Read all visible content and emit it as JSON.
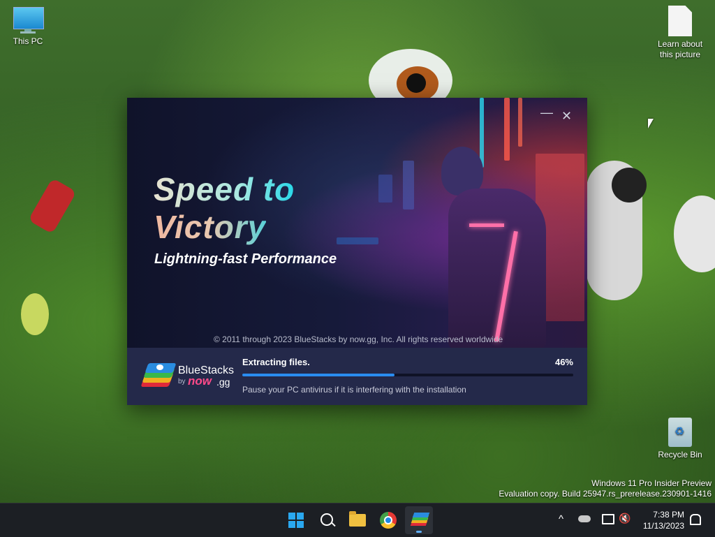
{
  "desktop": {
    "icons": {
      "this_pc": "This PC",
      "learn": "Learn about this picture",
      "recycle_bin": "Recycle Bin"
    },
    "watermark": {
      "line1": "Windows 11 Pro Insider Preview",
      "line2": "Evaluation copy. Build 25947.rs_prerelease.230901-1416"
    }
  },
  "installer": {
    "headline_1": "Speed to",
    "headline_2": "Victory",
    "subheadline": "Lightning-fast Performance",
    "copyright": "© 2011 through 2023 BlueStacks by now.gg, Inc. All rights reserved worldwide",
    "brand": "BlueStacks",
    "brand_by": "by",
    "brand_now": "now",
    "brand_gg": ".gg",
    "status": "Extracting files.",
    "progress_label": "46%",
    "progress": 0.46,
    "hint": "Pause your PC antivirus if it is interfering with the installation",
    "minimize_glyph": "—",
    "close_glyph": "✕"
  },
  "taskbar": {
    "apps": [
      "start-icon",
      "search-icon",
      "file-explorer-icon",
      "chrome-icon",
      "bluestacks-icon"
    ],
    "tray": [
      "chevron-up-icon",
      "onedrive-icon",
      "display-icon",
      "mute-icon"
    ],
    "time": "7:38 PM",
    "date": "11/13/2023",
    "tray_chevron": "^"
  },
  "colors": {
    "taskbar": "#1c1f24",
    "footer": "#24294a",
    "progress": "#2a8cf0",
    "now_pink": "#ff4a8a"
  }
}
